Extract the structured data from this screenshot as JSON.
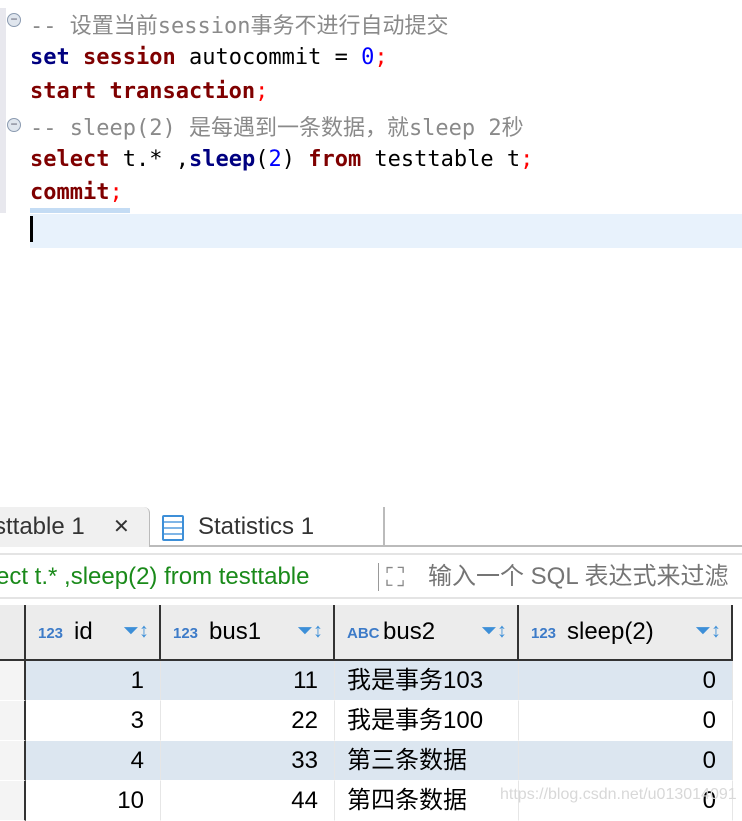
{
  "editor": {
    "lines": [
      {
        "comment": "-- 设置当前session事务不进行自动提交"
      },
      {
        "t1": "set",
        "t2": " session",
        "t3": " autocommit = ",
        "t4": "0",
        "t5": ";"
      },
      {
        "t1": "start transaction",
        "t2": ";"
      },
      {
        "comment": "-- sleep(2) 是每遇到一条数据，就sleep 2秒"
      },
      {
        "t1": "select",
        "t2": " t.* ,",
        "t3": "sleep",
        "t4": "(",
        "t5": "2",
        "t6": ") ",
        "t7": "from",
        "t8": " testtable t",
        "t9": ";"
      },
      {
        "t1": "commit",
        "t2": ";"
      }
    ]
  },
  "tabs": [
    {
      "label": "sttable 1",
      "close": "✕"
    },
    {
      "label": "Statistics 1"
    }
  ],
  "filter": {
    "query": "ect t.* ,sleep(2) from testtable",
    "placeholder": "输入一个 SQL 表达式来过滤"
  },
  "table": {
    "columns": [
      {
        "label": "id",
        "type": "123"
      },
      {
        "label": "bus1",
        "type": "123"
      },
      {
        "label": "bus2",
        "type": "ABC"
      },
      {
        "label": "sleep(2)",
        "type": "123"
      }
    ],
    "rows": [
      [
        "1",
        "11",
        "我是事务103",
        "0"
      ],
      [
        "3",
        "22",
        "我是事务100",
        "0"
      ],
      [
        "4",
        "33",
        "第三条数据",
        "0"
      ],
      [
        "10",
        "44",
        "第四条数据",
        "0"
      ]
    ]
  },
  "watermark": "https://blog.csdn.net/u013014091",
  "colors": {
    "keyword": "#7f0000",
    "function": "#000080",
    "number": "#0000ff",
    "comment": "#8a8a8a",
    "filter_text": "#1a8a1a",
    "selected_row": "#dce6f0"
  }
}
